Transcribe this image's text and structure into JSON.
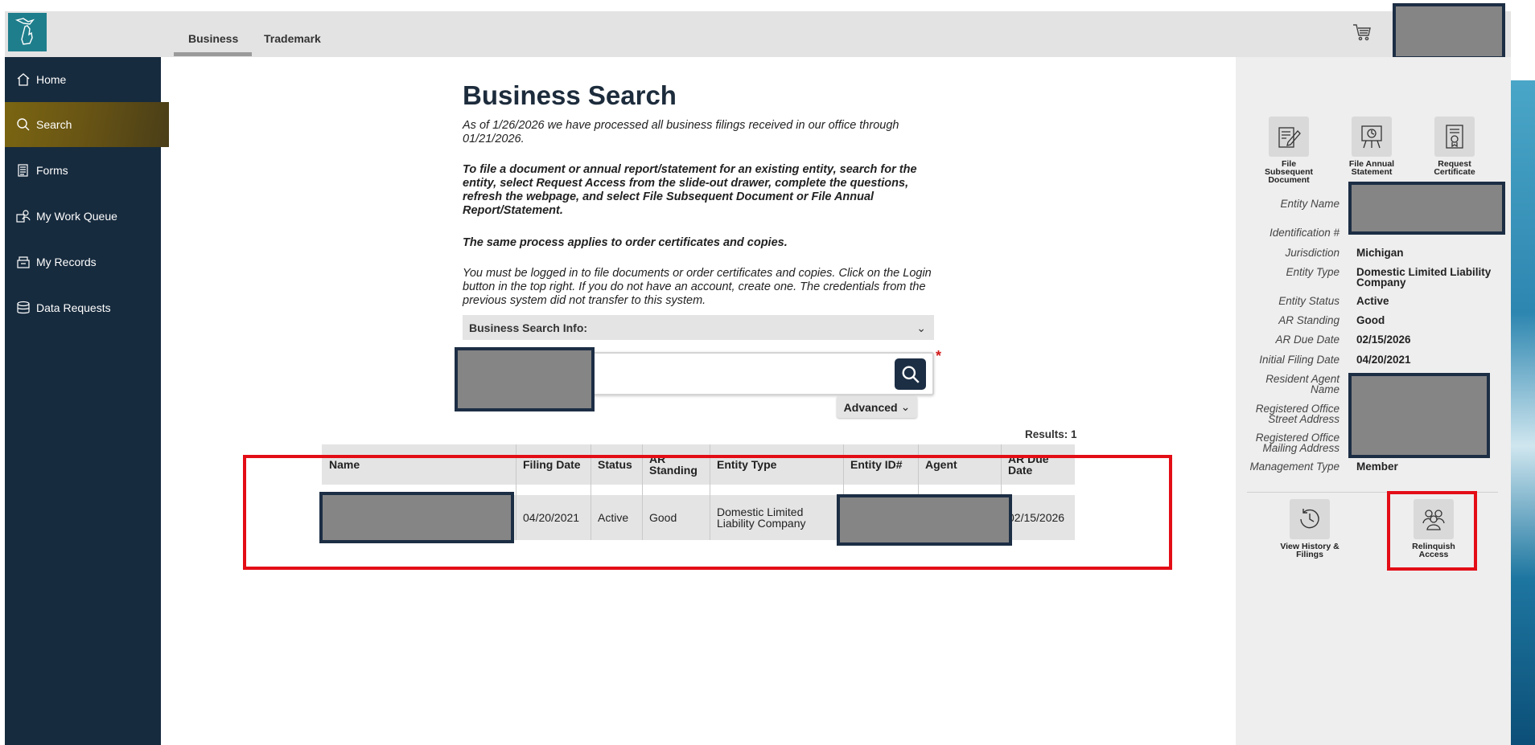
{
  "header": {
    "logo_icon": "michigan-logo-icon",
    "tabs": [
      {
        "label": "Business",
        "active": true
      },
      {
        "label": "Trademark",
        "active": false
      }
    ],
    "cart_icon": "cart-icon"
  },
  "sidebar": {
    "items": [
      {
        "label": "Home",
        "icon": "home-icon",
        "active": false
      },
      {
        "label": "Search",
        "icon": "search-icon",
        "active": true
      },
      {
        "label": "Forms",
        "icon": "forms-icon",
        "active": false
      },
      {
        "label": "My Work Queue",
        "icon": "work-queue-icon",
        "active": false
      },
      {
        "label": "My Records",
        "icon": "records-icon",
        "active": false
      },
      {
        "label": "Data Requests",
        "icon": "database-icon",
        "active": false
      }
    ]
  },
  "main": {
    "title": "Business Search",
    "intro": "As of 1/26/2026 we have processed all business filings received in our office through 01/21/2026.",
    "instructions": "To file a document or annual report/statement for an existing entity, search for the entity, select Request Access from the slide-out drawer, complete the questions, refresh the webpage, and select File Subsequent Document or File Annual Report/Statement.",
    "same_process": "The same process applies to order certificates and copies.",
    "login_note": "You must be logged in to file documents or order certificates and copies. Click on the Login button in the top right. If you do not have an account, create one. The credentials from the previous system did not transfer to this system.",
    "accordion_label": "Business Search Info:",
    "required_marker": "*",
    "advanced_label": "Advanced",
    "results_label": "Results: 1"
  },
  "table": {
    "columns": [
      "Name",
      "Filing Date",
      "Status",
      "AR Standing",
      "Entity Type",
      "Entity ID#",
      "Agent",
      "AR Due Date"
    ],
    "rows": [
      {
        "filing_date": "04/20/2021",
        "status": "Active",
        "ar_standing": "Good",
        "entity_type": "Domestic Limited Liability Company",
        "ar_due_date": "02/15/2026"
      }
    ]
  },
  "panel": {
    "actions": [
      {
        "label": "File Subsequent Document",
        "icon": "file-edit-icon"
      },
      {
        "label": "File Annual Statement",
        "icon": "annual-statement-icon"
      },
      {
        "label": "Request Certificate",
        "icon": "certificate-icon"
      }
    ],
    "fields": [
      {
        "label": "Entity Name",
        "value": ""
      },
      {
        "label": "Identification #",
        "value": ""
      },
      {
        "label": "Jurisdiction",
        "value": "Michigan"
      },
      {
        "label": "Entity Type",
        "value": "Domestic Limited Liability Company"
      },
      {
        "label": "Entity Status",
        "value": "Active"
      },
      {
        "label": "AR Standing",
        "value": "Good"
      },
      {
        "label": "AR Due Date",
        "value": "02/15/2026"
      },
      {
        "label": "Initial Filing Date",
        "value": "04/20/2021"
      },
      {
        "label": "Resident Agent Name",
        "value": ""
      },
      {
        "label": "Registered Office Street Address",
        "value": ""
      },
      {
        "label": "Registered Office Mailing Address",
        "value": ""
      },
      {
        "label": "Management Type",
        "value": "Member"
      }
    ],
    "bottom_actions": [
      {
        "label": "View History & Filings",
        "icon": "history-icon"
      },
      {
        "label": "Relinquish Access",
        "icon": "people-icon"
      }
    ]
  },
  "colors": {
    "sidebar_bg": "#172b3e",
    "active_nav": "#7a6512",
    "logo_bg": "#1f7e8c",
    "highlight_red": "#e30d16",
    "redaction": "#858585"
  }
}
